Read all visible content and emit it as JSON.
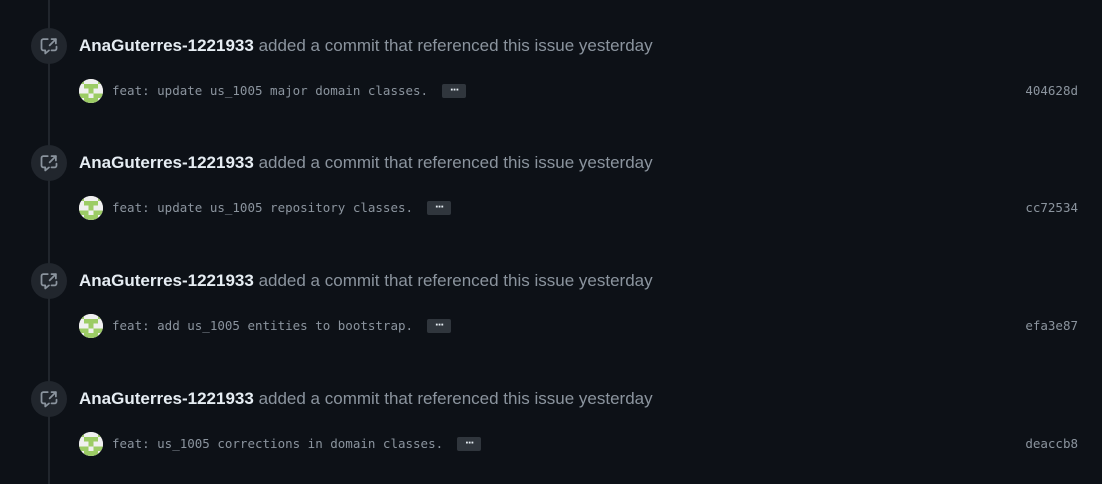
{
  "colors": {
    "background": "#0d1117",
    "badge": "#21262d",
    "text_muted": "#8b949e",
    "text_primary": "#e6edf3",
    "avatar_green": "#9ccc65"
  },
  "events": [
    {
      "icon": "cross-reference-icon",
      "author": "AnaGuterres-1221933",
      "action": "added a commit that referenced this issue",
      "time": "yesterday",
      "commit": {
        "message": "feat: update us_1005 major domain classes.",
        "ellipsis": "···",
        "sha": "404628d"
      }
    },
    {
      "icon": "cross-reference-icon",
      "author": "AnaGuterres-1221933",
      "action": "added a commit that referenced this issue",
      "time": "yesterday",
      "commit": {
        "message": "feat: update us_1005 repository classes.",
        "ellipsis": "···",
        "sha": "cc72534"
      }
    },
    {
      "icon": "cross-reference-icon",
      "author": "AnaGuterres-1221933",
      "action": "added a commit that referenced this issue",
      "time": "yesterday",
      "commit": {
        "message": "feat: add us_1005 entities to bootstrap.",
        "ellipsis": "···",
        "sha": "efa3e87"
      }
    },
    {
      "icon": "cross-reference-icon",
      "author": "AnaGuterres-1221933",
      "action": "added a commit that referenced this issue",
      "time": "yesterday",
      "commit": {
        "message": "feat: us_1005 corrections in domain classes.",
        "ellipsis": "···",
        "sha": "deaccb8"
      }
    }
  ]
}
